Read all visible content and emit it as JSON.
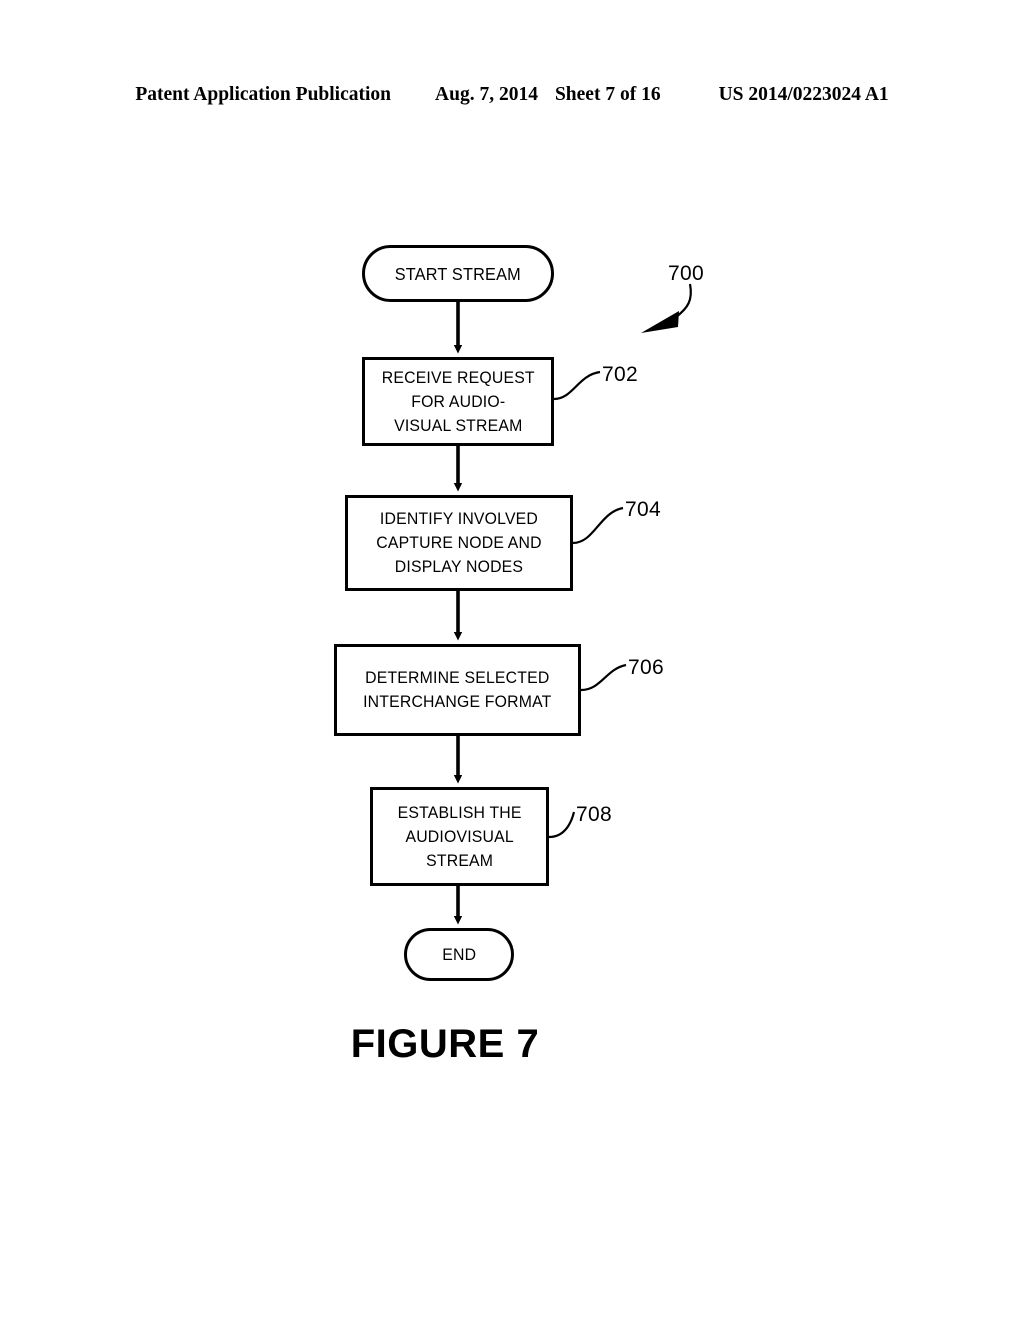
{
  "header": {
    "publication": "Patent Application Publication",
    "date": "Aug. 7, 2014",
    "sheet": "Sheet 7 of 16",
    "patent_number": "US 2014/0223024 A1"
  },
  "figure": {
    "caption": "FIGURE 7",
    "diagram_ref": "700",
    "nodes": [
      {
        "id": "start",
        "type": "terminator",
        "label": "START STREAM",
        "ref": ""
      },
      {
        "id": "702",
        "type": "process",
        "label": "RECEIVE REQUEST\nFOR AUDIO-\nVISUAL STREAM",
        "ref": "702"
      },
      {
        "id": "704",
        "type": "process",
        "label": "IDENTIFY INVOLVED\nCAPTURE NODE AND\nDISPLAY NODES",
        "ref": "704"
      },
      {
        "id": "706",
        "type": "process",
        "label": "DETERMINE SELECTED\nINTERCHANGE FORMAT",
        "ref": "706"
      },
      {
        "id": "708",
        "type": "process",
        "label": "ESTABLISH THE\nAUDIOVISUAL\nSTREAM",
        "ref": "708"
      },
      {
        "id": "end",
        "type": "terminator",
        "label": "END",
        "ref": ""
      }
    ],
    "colors": {
      "ink": "#000000",
      "paper": "#ffffff"
    }
  }
}
